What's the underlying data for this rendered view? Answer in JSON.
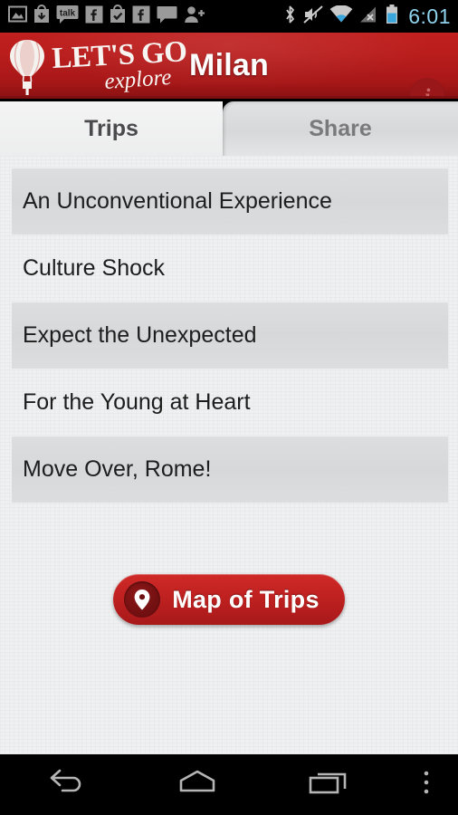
{
  "status_bar": {
    "notification_icons": [
      {
        "name": "gallery-icon",
        "label": "gallery"
      },
      {
        "name": "download-icon",
        "label": "download"
      },
      {
        "name": "talk-icon",
        "label": "talk"
      },
      {
        "name": "facebook-icon",
        "label": "f"
      },
      {
        "name": "play-store-icon",
        "label": "store"
      },
      {
        "name": "facebook-icon-2",
        "label": "f"
      },
      {
        "name": "message-icon",
        "label": "message"
      },
      {
        "name": "add-contact-icon",
        "label": "add contact"
      }
    ],
    "system_icons": [
      {
        "name": "bluetooth-icon"
      },
      {
        "name": "volume-muted-icon"
      },
      {
        "name": "wifi-icon"
      },
      {
        "name": "cellular-no-signal-icon"
      },
      {
        "name": "battery-icon"
      }
    ],
    "clock": "6:01",
    "clock_color": "#8fd3ee",
    "background": "#000000"
  },
  "header": {
    "title": "Milan",
    "logo": {
      "brand_line1": "LET'S GO",
      "brand_line2": "explore",
      "icon": "hot-air-balloon-icon"
    },
    "info_button_label": "i",
    "background_color": "#b91d1c",
    "title_color": "#fdfdfd"
  },
  "tabs": [
    {
      "label": "Trips",
      "active": true
    },
    {
      "label": "Share",
      "active": false
    }
  ],
  "trips": [
    {
      "title": "An Unconventional Experience",
      "shaded": true
    },
    {
      "title": "Culture Shock",
      "shaded": false
    },
    {
      "title": "Expect the Unexpected",
      "shaded": true
    },
    {
      "title": "For the Young at Heart",
      "shaded": false
    },
    {
      "title": "Move Over, Rome!",
      "shaded": true
    }
  ],
  "map_button": {
    "label": "Map of Trips",
    "icon": "map-pin-icon",
    "background_color": "#bf2120",
    "text_color": "#ffffff"
  },
  "nav_bar": {
    "buttons": [
      {
        "name": "back-button",
        "icon": "back-arrow-icon"
      },
      {
        "name": "home-button",
        "icon": "home-icon"
      },
      {
        "name": "recents-button",
        "icon": "recents-icon"
      },
      {
        "name": "overflow-button",
        "icon": "overflow-menu-icon"
      }
    ],
    "background": "#000000"
  }
}
